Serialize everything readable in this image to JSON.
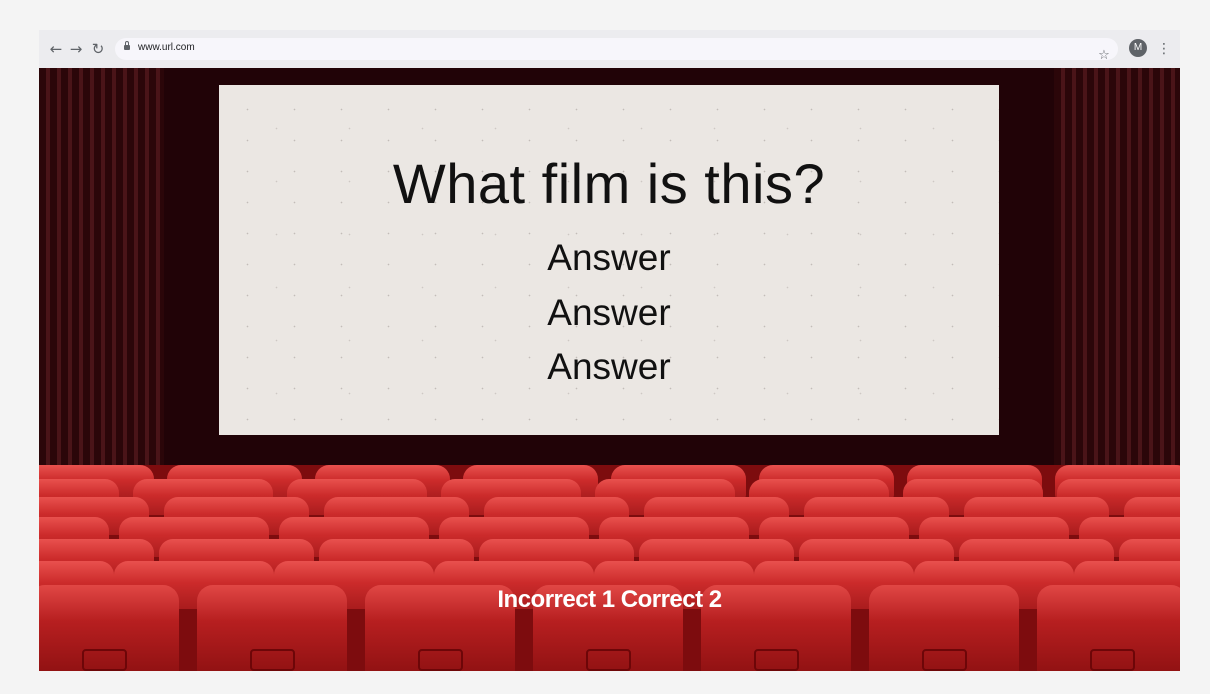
{
  "browser": {
    "url": "www.url.com",
    "profile_initial": "M",
    "back_glyph": "←",
    "forward_glyph": "→",
    "reload_glyph": "↻",
    "star_glyph": "☆",
    "menu_glyph": "⋮"
  },
  "quiz": {
    "question": "What film is this?",
    "answers": [
      "Answer",
      "Answer",
      "Answer"
    ],
    "score_text": "Incorrect 1 Correct 2"
  },
  "colors": {
    "screen": "#ebe7e3",
    "background": "#210307",
    "seat_red": "#cc2b2b",
    "seat_dark": "#7d0c0e"
  }
}
